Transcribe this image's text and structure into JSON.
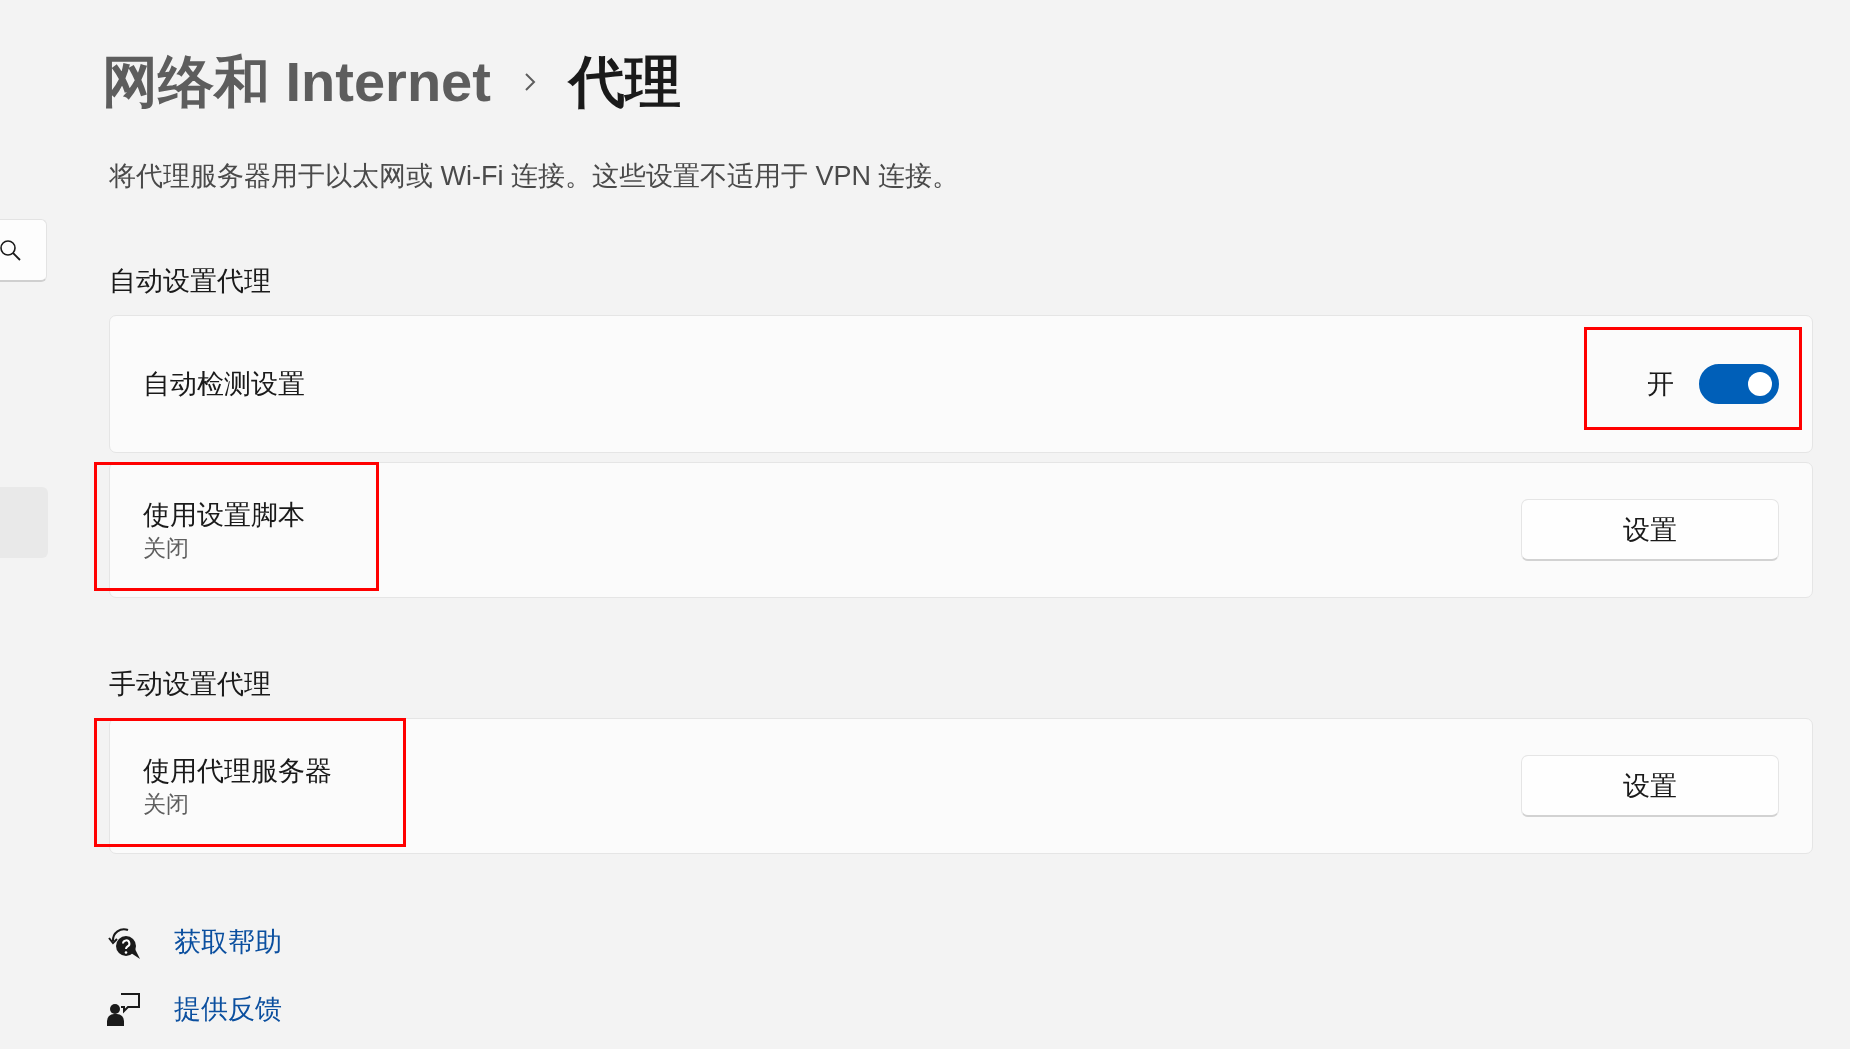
{
  "breadcrumb": {
    "parent": "网络和 Internet",
    "current": "代理"
  },
  "description": "将代理服务器用于以太网或 Wi-Fi 连接。这些设置不适用于 VPN 连接。",
  "sections": [
    {
      "title": "自动设置代理",
      "rows": [
        {
          "kind": "toggle",
          "title": "自动检测设置",
          "toggle_label": "开",
          "on": true,
          "label_highlighted": false,
          "control_highlighted": true
        },
        {
          "kind": "button",
          "title": "使用设置脚本",
          "subtitle": "关闭",
          "button": "设置",
          "label_highlighted": true,
          "control_highlighted": false
        }
      ]
    },
    {
      "title": "手动设置代理",
      "rows": [
        {
          "kind": "button",
          "title": "使用代理服务器",
          "subtitle": "关闭",
          "button": "设置",
          "label_highlighted": true,
          "control_highlighted": false
        }
      ]
    }
  ],
  "links": [
    {
      "kind": "help",
      "label": "获取帮助"
    },
    {
      "kind": "feedback",
      "label": "提供反馈"
    }
  ]
}
